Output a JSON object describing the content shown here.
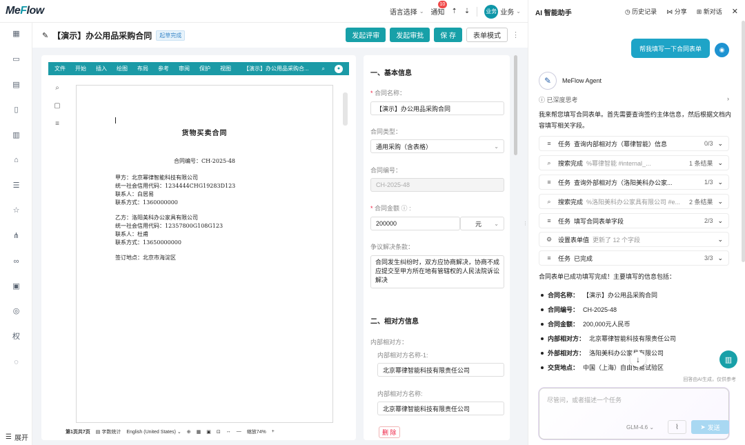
{
  "header": {
    "logo_pre": "Me",
    "logo_w": "F",
    "logo_post": "low",
    "lang": "语言选择",
    "notify": "通知",
    "notify_count": "10",
    "user_avatar": "业务",
    "user": "业务"
  },
  "toolbar": {
    "title": "【演示】办公用品采购合同",
    "tag": "起草完成",
    "b1": "发起评审",
    "b2": "发起审批",
    "b3": "保 存",
    "b4": "表单模式"
  },
  "sidebar": {
    "expand": "展开",
    "auth": "权"
  },
  "doc": {
    "ribbon": [
      "文件",
      "开始",
      "插入",
      "绘图",
      "布局",
      "参考",
      "审阅",
      "保护",
      "视图"
    ],
    "doc_title": "【演示】办公用品采购合...",
    "title": "货物买卖合同",
    "no": "合同编号：CH-2025-48",
    "a": [
      "甲方：北京幂律智能科技有限公司",
      "统一社会信用代码：1234444CHG19283D123",
      "联系人：白居易",
      "联系方式：1360000000"
    ],
    "b": [
      "乙方：洛阳美科办公家具有限公司",
      "统一社会信用代码：12357800G108G123",
      "联系人：杜甫",
      "联系方式：13650000000"
    ],
    "place": "签订地点：北京市海淀区",
    "status": {
      "page": "第1页共7页",
      "wc": "字数统计",
      "lang": "English (United States)",
      "zoom": "缩放74%"
    }
  },
  "form": {
    "s1": "一、基本信息",
    "name_l": "合同名称：",
    "name_v": "【演示】办公用品采购合同",
    "type_l": "合同类型：",
    "type_v": "通用采购（含表格）",
    "no_l": "合同编号：",
    "no_v": "CH-2025-48",
    "amt_l": "合同金额",
    "amt_v": "200000",
    "amt_u": "元",
    "disp_l": "争议解决条款：",
    "disp_v": "合同发生纠纷时，双方应协商解决，协商不成应提交至甲方所在地有管辖权的人民法院诉讼解决",
    "s2": "二、相对方信息",
    "int_l": "内部相对方：",
    "int1_l": "内部相对方名称-1:",
    "int1_v": "北京幂律智能科技有限责任公司",
    "int2_l": "内部相对方名称:",
    "int2_v": "北京幂律智能科技有限责任公司",
    "del": "删 除"
  },
  "ai": {
    "title": "AI 智能助手",
    "history": "历史记录",
    "share": "分享",
    "new": "新对话",
    "user_msg": "帮我填写一下合同表单",
    "agent": "MeFlow Agent",
    "thinking": "已深度思考",
    "intro": "我来帮您填写合同表单。首先需要查询签约主体信息，然后根据文档内容填写相关字段。",
    "tasks": [
      {
        "icon": "≡",
        "t": "任务",
        "d": "查询内部相对方（幂律智能）信息",
        "m": "",
        "c": "0/3"
      },
      {
        "icon": "⌕",
        "t": "搜索完成",
        "d": "",
        "m": "%幂律智能 #internal_...",
        "c": "1 条结果"
      },
      {
        "icon": "≡",
        "t": "任务",
        "d": "查询外部相对方（洛阳美科办公家...",
        "m": "",
        "c": "1/3"
      },
      {
        "icon": "⌕",
        "t": "搜索完成",
        "d": "",
        "m": "%洛阳美科办公家具有限公司 #e...",
        "c": "2 条结果"
      },
      {
        "icon": "≡",
        "t": "任务",
        "d": "填写合同表单字段",
        "m": "",
        "c": "2/3"
      },
      {
        "icon": "⚙",
        "t": "设置表单值",
        "d": "",
        "m": "更新了 12 个字段",
        "c": ""
      },
      {
        "icon": "≡",
        "t": "任务",
        "d": "已完成",
        "m": "",
        "c": "3/3"
      }
    ],
    "done": "合同表单已成功填写完成！主要填写的信息包括：",
    "items": [
      {
        "k": "合同名称：",
        "v": "【演示】办公用品采购合同"
      },
      {
        "k": "合同编号：",
        "v": "CH-2025-48"
      },
      {
        "k": "合同金额：",
        "v": "200,000元人民币"
      },
      {
        "k": "内部相对方：",
        "v": "北京幂律智能科技有限责任公司"
      },
      {
        "k": "外部相对方：",
        "v": "洛阳美科办公家具有限公司"
      },
      {
        "k": "交货地点：",
        "v": "中国（上海）自由贸易试验区"
      }
    ],
    "notice": "回答由AI生成，仅供参考",
    "placeholder": "尽管问，或者描述一个任务",
    "model": "GLM-4.6",
    "send": "发送"
  }
}
